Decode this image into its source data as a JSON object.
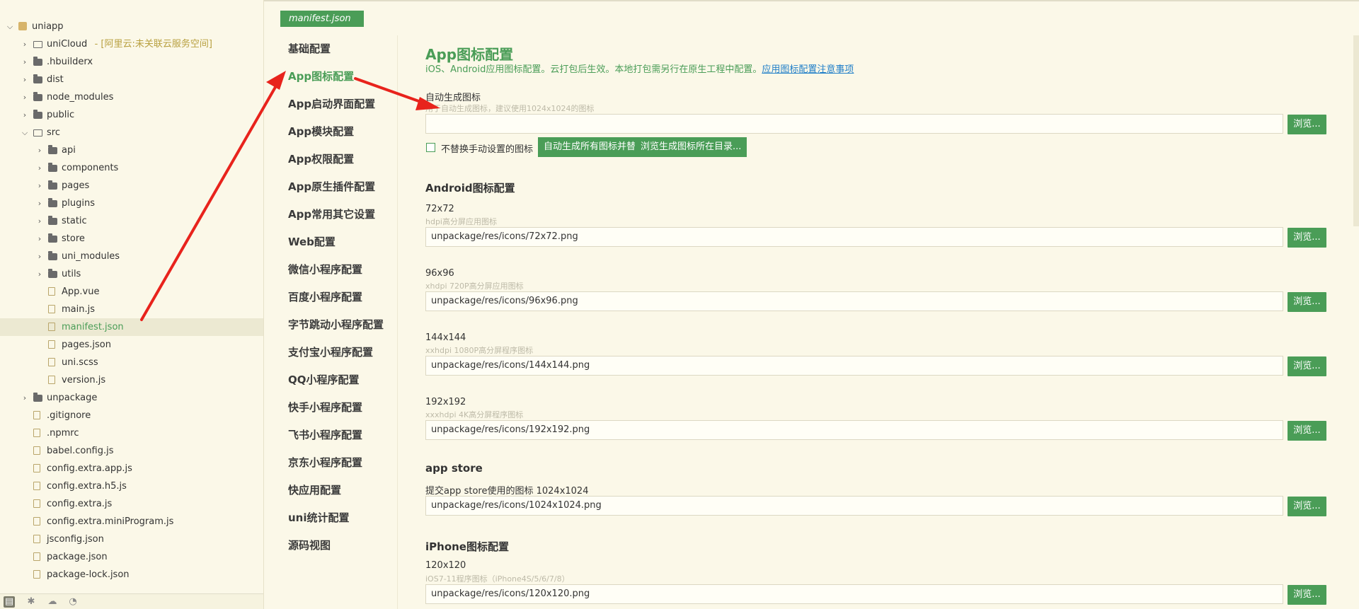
{
  "explorer": {
    "items": [
      {
        "label": "uniapp",
        "depth": 0,
        "type": "project",
        "chevron": "open"
      },
      {
        "label": "uniCloud",
        "extra": " - [阿里云:未关联云服务空间]",
        "depth": 1,
        "type": "folder-open",
        "chevron": "closed"
      },
      {
        "label": ".hbuilderx",
        "depth": 1,
        "type": "folder",
        "chevron": "closed"
      },
      {
        "label": "dist",
        "depth": 1,
        "type": "folder",
        "chevron": "closed"
      },
      {
        "label": "node_modules",
        "depth": 1,
        "type": "folder",
        "chevron": "closed"
      },
      {
        "label": "public",
        "depth": 1,
        "type": "folder",
        "chevron": "closed"
      },
      {
        "label": "src",
        "depth": 1,
        "type": "folder-open",
        "chevron": "open"
      },
      {
        "label": "api",
        "depth": 2,
        "type": "folder",
        "chevron": "closed"
      },
      {
        "label": "components",
        "depth": 2,
        "type": "folder",
        "chevron": "closed"
      },
      {
        "label": "pages",
        "depth": 2,
        "type": "folder",
        "chevron": "closed"
      },
      {
        "label": "plugins",
        "depth": 2,
        "type": "folder",
        "chevron": "closed"
      },
      {
        "label": "static",
        "depth": 2,
        "type": "folder",
        "chevron": "closed"
      },
      {
        "label": "store",
        "depth": 2,
        "type": "folder",
        "chevron": "closed"
      },
      {
        "label": "uni_modules",
        "depth": 2,
        "type": "folder",
        "chevron": "closed"
      },
      {
        "label": "utils",
        "depth": 2,
        "type": "folder",
        "chevron": "closed"
      },
      {
        "label": "App.vue",
        "depth": 2,
        "type": "file"
      },
      {
        "label": "main.js",
        "depth": 2,
        "type": "file"
      },
      {
        "label": "manifest.json",
        "depth": 2,
        "type": "file",
        "active": true
      },
      {
        "label": "pages.json",
        "depth": 2,
        "type": "file"
      },
      {
        "label": "uni.scss",
        "depth": 2,
        "type": "file"
      },
      {
        "label": "version.js",
        "depth": 2,
        "type": "file"
      },
      {
        "label": "unpackage",
        "depth": 1,
        "type": "folder",
        "chevron": "closed"
      },
      {
        "label": ".gitignore",
        "depth": 1,
        "type": "file"
      },
      {
        "label": ".npmrc",
        "depth": 1,
        "type": "file"
      },
      {
        "label": "babel.config.js",
        "depth": 1,
        "type": "file"
      },
      {
        "label": "config.extra.app.js",
        "depth": 1,
        "type": "file"
      },
      {
        "label": "config.extra.h5.js",
        "depth": 1,
        "type": "file"
      },
      {
        "label": "config.extra.js",
        "depth": 1,
        "type": "file"
      },
      {
        "label": "config.extra.miniProgram.js",
        "depth": 1,
        "type": "file"
      },
      {
        "label": "jsconfig.json",
        "depth": 1,
        "type": "file"
      },
      {
        "label": "package.json",
        "depth": 1,
        "type": "file"
      },
      {
        "label": "package-lock.json",
        "depth": 1,
        "type": "file"
      }
    ]
  },
  "editor": {
    "tab_label": "manifest.json",
    "nav": [
      "基础配置",
      "App图标配置",
      "App启动界面配置",
      "App模块配置",
      "App权限配置",
      "App原生插件配置",
      "App常用其它设置",
      "Web配置",
      "微信小程序配置",
      "百度小程序配置",
      "字节跳动小程序配置",
      "支付宝小程序配置",
      "QQ小程序配置",
      "快手小程序配置",
      "飞书小程序配置",
      "京东小程序配置",
      "快应用配置",
      "uni统计配置",
      "源码视图"
    ],
    "active_nav_index": 1,
    "page": {
      "title": "App图标配置",
      "desc": "iOS、Android应用图标配置。云打包后生效。本地打包需另行在原生工程中配置。",
      "desc_link": "应用图标配置注意事项",
      "auto": {
        "label": "自动生成图标",
        "hint": "用于自动生成图标，建议使用1024x1024的图标",
        "value": "",
        "checkbox_label": "不替换手动设置的图标",
        "generate_btn": "自动生成所有图标并替换",
        "browse_dir_btn": "浏览生成图标所在目录..."
      },
      "browse_label": "浏览...",
      "android": {
        "title": "Android图标配置",
        "fields": [
          {
            "label": "72x72",
            "hint": "hdpi高分屏应用图标",
            "value": "unpackage/res/icons/72x72.png"
          },
          {
            "label": "96x96",
            "hint": "xhdpi 720P高分屏应用图标",
            "value": "unpackage/res/icons/96x96.png"
          },
          {
            "label": "144x144",
            "hint": "xxhdpi 1080P高分屏程序图标",
            "value": "unpackage/res/icons/144x144.png"
          },
          {
            "label": "192x192",
            "hint": "xxxhdpi 4K高分屏程序图标",
            "value": "unpackage/res/icons/192x192.png"
          }
        ]
      },
      "appstore": {
        "title": "app store",
        "label": "提交app store使用的图标 1024x1024",
        "value": "unpackage/res/icons/1024x1024.png"
      },
      "iphone": {
        "title": "iPhone图标配置",
        "label": "120x120",
        "hint": "iOS7-11程序图标（iPhone4S/5/6/7/8）",
        "value": "unpackage/res/icons/120x120.png"
      }
    }
  },
  "colors": {
    "accent": "#4a9d57",
    "background": "#fbf8e8",
    "link": "#1f7ec8",
    "annotation": "#e8231c"
  }
}
